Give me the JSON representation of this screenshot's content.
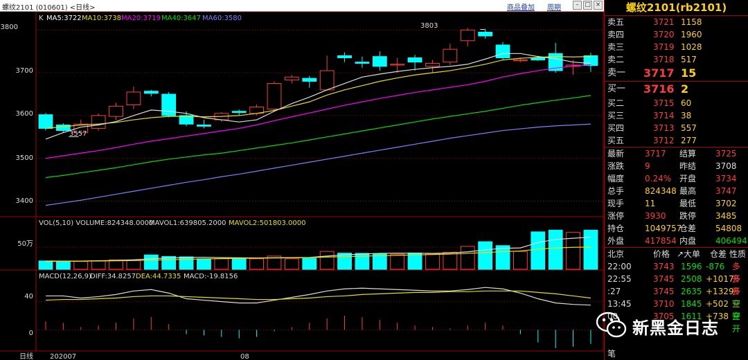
{
  "titlebar": {
    "title": "螺纹2101 (010601) <日线>",
    "link_overlay": "商品叠加",
    "link_period": "周期"
  },
  "chart": {
    "k_label": "K",
    "ma": [
      {
        "label": "MA5:3722",
        "color": "#ffffff"
      },
      {
        "label": "MA10:3738",
        "color": "#e8e000"
      },
      {
        "label": "MA20:3719",
        "color": "#ff00ff"
      },
      {
        "label": "MA40:3647",
        "color": "#00e000"
      },
      {
        "label": "MA60:3580",
        "color": "#8080ff"
      }
    ],
    "price_ticks": [
      "3800",
      "3700",
      "3600",
      "3500",
      "3400"
    ],
    "high_annot": "3803",
    "low_annot": "3557",
    "vol_header": {
      "vol": "VOL(5,10) VOLUME:824348.0000",
      "mavol1": "MAVOL1:639805.2000",
      "mavol2": "MAVOL2:501803.0000"
    },
    "vol_tick": "50万",
    "macd_header": {
      "macd": "MACD(12,26,9)",
      "diff": "DIFF:34.8257",
      "dea": "DEA:44.7335",
      "macdv": "MACD:-19.8156"
    },
    "macd_ticks": [
      "40",
      "0"
    ],
    "x_labels": [
      "日线",
      "202007",
      "08"
    ]
  },
  "chart_data": {
    "type": "candlestick",
    "price_range": [
      3370,
      3820
    ],
    "candles": [
      [
        3602,
        3570,
        3606,
        3565
      ],
      [
        3578,
        3565,
        3582,
        3560
      ],
      [
        3560,
        3580,
        3590,
        3557
      ],
      [
        3570,
        3600,
        3605,
        3565
      ],
      [
        3598,
        3622,
        3630,
        3590
      ],
      [
        3625,
        3655,
        3668,
        3615
      ],
      [
        3657,
        3652,
        3660,
        3645
      ],
      [
        3650,
        3600,
        3655,
        3596
      ],
      [
        3600,
        3580,
        3610,
        3575
      ],
      [
        3578,
        3575,
        3590,
        3570
      ],
      [
        3590,
        3605,
        3608,
        3585
      ],
      [
        3610,
        3607,
        3614,
        3600
      ],
      [
        3605,
        3620,
        3626,
        3600
      ],
      [
        3615,
        3675,
        3680,
        3610
      ],
      [
        3683,
        3690,
        3695,
        3675
      ],
      [
        3687,
        3680,
        3693,
        3665
      ],
      [
        3660,
        3705,
        3740,
        3658
      ],
      [
        3740,
        3735,
        3748,
        3725
      ],
      [
        3725,
        3722,
        3738,
        3712
      ],
      [
        3738,
        3715,
        3750,
        3705
      ],
      [
        3718,
        3720,
        3735,
        3700
      ],
      [
        3735,
        3725,
        3742,
        3705
      ],
      [
        3715,
        3722,
        3730,
        3700
      ],
      [
        3725,
        3755,
        3768,
        3718
      ],
      [
        3775,
        3800,
        3805,
        3762
      ],
      [
        3795,
        3786,
        3803,
        3780
      ],
      [
        3765,
        3735,
        3772,
        3730
      ],
      [
        3728,
        3730,
        3735,
        3725
      ],
      [
        3735,
        3730,
        3740,
        3728
      ],
      [
        3745,
        3705,
        3770,
        3700
      ],
      [
        3715,
        3718,
        3730,
        3695
      ],
      [
        3740,
        3717,
        3747,
        3702
      ]
    ],
    "ma5": [
      3545,
      3560,
      3573,
      3578,
      3586,
      3600,
      3613,
      3610,
      3605,
      3595,
      3590,
      3585,
      3590,
      3610,
      3628,
      3643,
      3660,
      3675,
      3690,
      3697,
      3703,
      3708,
      3712,
      3715,
      3720,
      3732,
      3745,
      3745,
      3738,
      3733,
      3725,
      3722
    ],
    "ma10": [
      3570,
      3574,
      3578,
      3580,
      3584,
      3590,
      3595,
      3598,
      3598,
      3597,
      3598,
      3600,
      3605,
      3612,
      3622,
      3632,
      3648,
      3660,
      3670,
      3680,
      3688,
      3695,
      3700,
      3705,
      3712,
      3720,
      3730,
      3734,
      3736,
      3738,
      3737,
      3738
    ],
    "ma20": [
      3500,
      3506,
      3512,
      3518,
      3525,
      3533,
      3540,
      3546,
      3552,
      3558,
      3564,
      3570,
      3578,
      3588,
      3597,
      3606,
      3615,
      3624,
      3632,
      3640,
      3647,
      3654,
      3660,
      3666,
      3672,
      3680,
      3690,
      3698,
      3705,
      3711,
      3716,
      3719
    ],
    "ma40": [
      3455,
      3460,
      3466,
      3472,
      3478,
      3485,
      3492,
      3498,
      3503,
      3508,
      3512,
      3518,
      3524,
      3530,
      3536,
      3543,
      3550,
      3557,
      3564,
      3571,
      3578,
      3585,
      3592,
      3598,
      3604,
      3610,
      3617,
      3624,
      3630,
      3636,
      3641,
      3647
    ],
    "ma60": [
      3390,
      3396,
      3402,
      3409,
      3416,
      3423,
      3430,
      3437,
      3444,
      3450,
      3457,
      3463,
      3470,
      3477,
      3484,
      3491,
      3498,
      3505,
      3512,
      3519,
      3526,
      3533,
      3540,
      3547,
      3553,
      3559,
      3565,
      3569,
      3573,
      3576,
      3578,
      3580
    ],
    "volume": [
      145000,
      120000,
      130000,
      145000,
      170000,
      155000,
      300000,
      260000,
      250000,
      200000,
      200000,
      195000,
      200000,
      270000,
      200000,
      210000,
      390000,
      345000,
      340000,
      335000,
      320000,
      350000,
      330000,
      370000,
      520000,
      640000,
      540000,
      390000,
      895000,
      940000,
      880000,
      940000
    ],
    "volume_range": [
      0,
      1000000
    ],
    "mavol1": [
      140000,
      140000,
      142000,
      150000,
      160000,
      175000,
      200000,
      220000,
      235000,
      240000,
      230000,
      225000,
      222000,
      228000,
      230000,
      235000,
      270000,
      300000,
      320000,
      340000,
      345000,
      345000,
      340000,
      348000,
      380000,
      430000,
      470000,
      480000,
      620000,
      700000,
      730000,
      760000
    ],
    "mavol2": [
      130000,
      135000,
      138000,
      142000,
      150000,
      155000,
      165000,
      175000,
      185000,
      195000,
      205000,
      210000,
      215000,
      220000,
      225000,
      230000,
      245000,
      255000,
      265000,
      280000,
      290000,
      300000,
      310000,
      320000,
      340000,
      360000,
      385000,
      400000,
      450000,
      480000,
      495000,
      501803
    ],
    "diff": [
      48,
      48,
      45,
      47,
      50,
      55,
      57,
      52,
      44,
      42,
      40,
      38,
      38,
      42,
      46,
      50,
      55,
      58,
      59,
      58,
      57,
      56,
      55,
      55,
      57,
      60,
      58,
      52,
      44,
      38,
      36,
      35
    ],
    "dea": [
      42,
      43,
      43,
      44,
      45,
      47,
      48,
      48,
      47,
      46,
      45,
      44,
      43,
      43,
      44,
      45,
      47,
      48,
      50,
      51,
      52,
      53,
      53,
      54,
      54,
      55,
      55,
      55,
      53,
      51,
      48,
      45
    ],
    "macd": [
      12,
      10,
      4,
      6,
      10,
      16,
      18,
      8,
      -6,
      -8,
      -10,
      -12,
      -10,
      -2,
      4,
      10,
      16,
      20,
      18,
      14,
      10,
      6,
      4,
      2,
      6,
      10,
      6,
      -6,
      -18,
      -26,
      -24,
      -20
    ],
    "macd_range": [
      -30,
      70
    ]
  },
  "quote": {
    "title": "螺纹2101(rb2101)",
    "sell": [
      {
        "label": "卖五",
        "price": "3721",
        "vol": "1158"
      },
      {
        "label": "卖四",
        "price": "3720",
        "vol": "1960"
      },
      {
        "label": "卖三",
        "price": "3719",
        "vol": "1028"
      },
      {
        "label": "卖二",
        "price": "3718",
        "vol": "517"
      }
    ],
    "sell1": {
      "label": "卖一",
      "price": "3717",
      "vol": "15"
    },
    "buy1": {
      "label": "买一",
      "price": "3716",
      "vol": "2"
    },
    "buy": [
      {
        "label": "买二",
        "price": "3715",
        "vol": "60"
      },
      {
        "label": "买三",
        "price": "3714",
        "vol": "38"
      },
      {
        "label": "买四",
        "price": "3713",
        "vol": "557"
      },
      {
        "label": "买五",
        "price": "3712",
        "vol": "277"
      }
    ],
    "stats": [
      [
        {
          "l": "最新",
          "v": "3717",
          "c": "red"
        },
        {
          "l": "结算",
          "v": "3725",
          "c": "red"
        }
      ],
      [
        {
          "l": "涨跌",
          "v": "9",
          "c": "red"
        },
        {
          "l": "昨结",
          "v": "3708",
          "c": "wht"
        }
      ],
      [
        {
          "l": "幅度",
          "v": "0.24%",
          "c": "red"
        },
        {
          "l": "开盘",
          "v": "3734",
          "c": "red"
        }
      ],
      [
        {
          "l": "总手",
          "v": "824348",
          "c": "yel"
        },
        {
          "l": "最高",
          "v": "3747",
          "c": "red"
        }
      ],
      [
        {
          "l": "现手",
          "v": "11",
          "c": "yel"
        },
        {
          "l": "最低",
          "v": "3702",
          "c": "yel"
        }
      ],
      [
        {
          "l": "涨停",
          "v": "3930",
          "c": "red"
        },
        {
          "l": "跌停",
          "v": "3485",
          "c": "yel"
        }
      ],
      [
        {
          "l": "持仓",
          "v": "1049757",
          "c": "yel"
        },
        {
          "l": "仓差",
          "v": "54808",
          "c": "yel"
        }
      ],
      [
        {
          "l": "外盘",
          "v": "417854",
          "c": "red"
        },
        {
          "l": "内盘",
          "v": "406494",
          "c": "grn"
        }
      ]
    ],
    "ticks_header": {
      "loc": "北京",
      "price": "价格",
      "vol": "↗大单",
      "chg": "仓差",
      "type": "性质"
    },
    "ticks": [
      {
        "time": "22:00",
        "price": "3743",
        "vol": "1596",
        "chg": "-876",
        "type": "多开",
        "chgc": "grn",
        "tc": "red"
      },
      {
        "time": "22:55",
        "price": "3745",
        "vol": "2508",
        "chg": "+1017",
        "type": "多开",
        "chgc": "yel",
        "tc": "red"
      },
      {
        "time": ":27",
        "price": "3745",
        "vol": "2635",
        "chg": "+1329",
        "type": "多开",
        "chgc": "yel",
        "tc": "red"
      },
      {
        "time": "13:45",
        "price": "3710",
        "vol": "1845",
        "chg": "+502",
        "type": "空开",
        "chgc": "yel",
        "tc": "grn"
      },
      {
        "time": "00",
        "price": "3705",
        "vol": "1611",
        "chg": "+738",
        "type": "空开",
        "chgc": "yel",
        "tc": "grn"
      }
    ],
    "bottom_label": "笔"
  },
  "watermark": {
    "text": "新黑金日志"
  }
}
